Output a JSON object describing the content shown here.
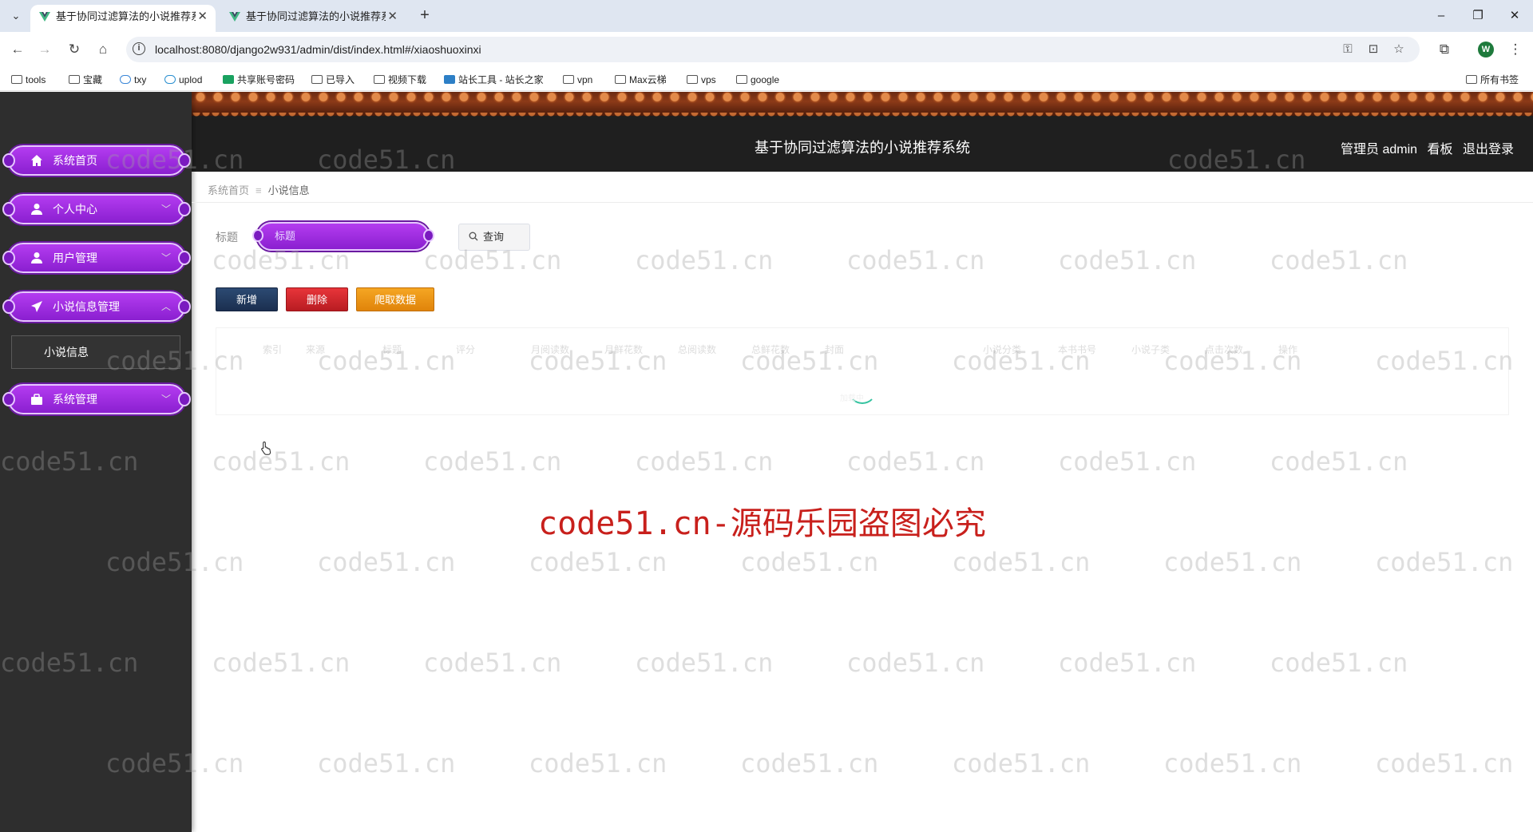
{
  "browser": {
    "tabs": [
      {
        "title": "基于协同过滤算法的小说推荐系",
        "active": true
      },
      {
        "title": "基于协同过滤算法的小说推荐系",
        "active": false
      }
    ],
    "url": "localhost:8080/django2w931/admin/dist/index.html#/xiaoshuoxinxi",
    "bookmarks": [
      "tools",
      "宝藏",
      "txy",
      "uplod",
      "共享账号密码",
      "已导入",
      "视频下载",
      "站长工具 - 站长之家",
      "vpn",
      "Max云梯",
      "vps",
      "google"
    ],
    "all_bookmarks": "所有书签",
    "profile_initial": "W"
  },
  "header": {
    "title": "基于协同过滤算法的小说推荐系统",
    "user": "管理员 admin",
    "board": "看板",
    "logout": "退出登录"
  },
  "sidebar": {
    "items": [
      {
        "label": "系统首页",
        "icon": "home-icon",
        "expandable": false
      },
      {
        "label": "个人中心",
        "icon": "user-icon",
        "expandable": true
      },
      {
        "label": "用户管理",
        "icon": "user-icon",
        "expandable": true
      },
      {
        "label": "小说信息管理",
        "icon": "paper-plane-icon",
        "expandable": true,
        "expanded": true
      },
      {
        "label": "系统管理",
        "icon": "briefcase-icon",
        "expandable": true
      }
    ],
    "submenu_item": "小说信息"
  },
  "breadcrumb": {
    "home": "系统首页",
    "separator": "≡",
    "current": "小说信息"
  },
  "search": {
    "label": "标题",
    "placeholder": "标题",
    "button": "查询"
  },
  "actions": {
    "add": "新增",
    "delete": "删除",
    "crawl": "爬取数据"
  },
  "table": {
    "columns": [
      "索引",
      "来源",
      "标题",
      "评分",
      "月阅读数",
      "月鲜花数",
      "总阅读数",
      "总鲜花数",
      "封面",
      "小说分类",
      "本书书号",
      "小说子类",
      "点击次数",
      "操作"
    ],
    "loading_text": "加载中"
  },
  "watermark": {
    "text": "code51.cn",
    "main": "code51.cn-源码乐园盗图必究"
  },
  "colors": {
    "menu_purple": "#9a2ae0",
    "sidebar_bg": "#2e2e2e",
    "header_bg": "#1f1f1f",
    "add_btn": "#1b2f4f",
    "delete_btn": "#d32027",
    "crawl_btn": "#f08c14",
    "watermark_red": "#c8201c"
  }
}
